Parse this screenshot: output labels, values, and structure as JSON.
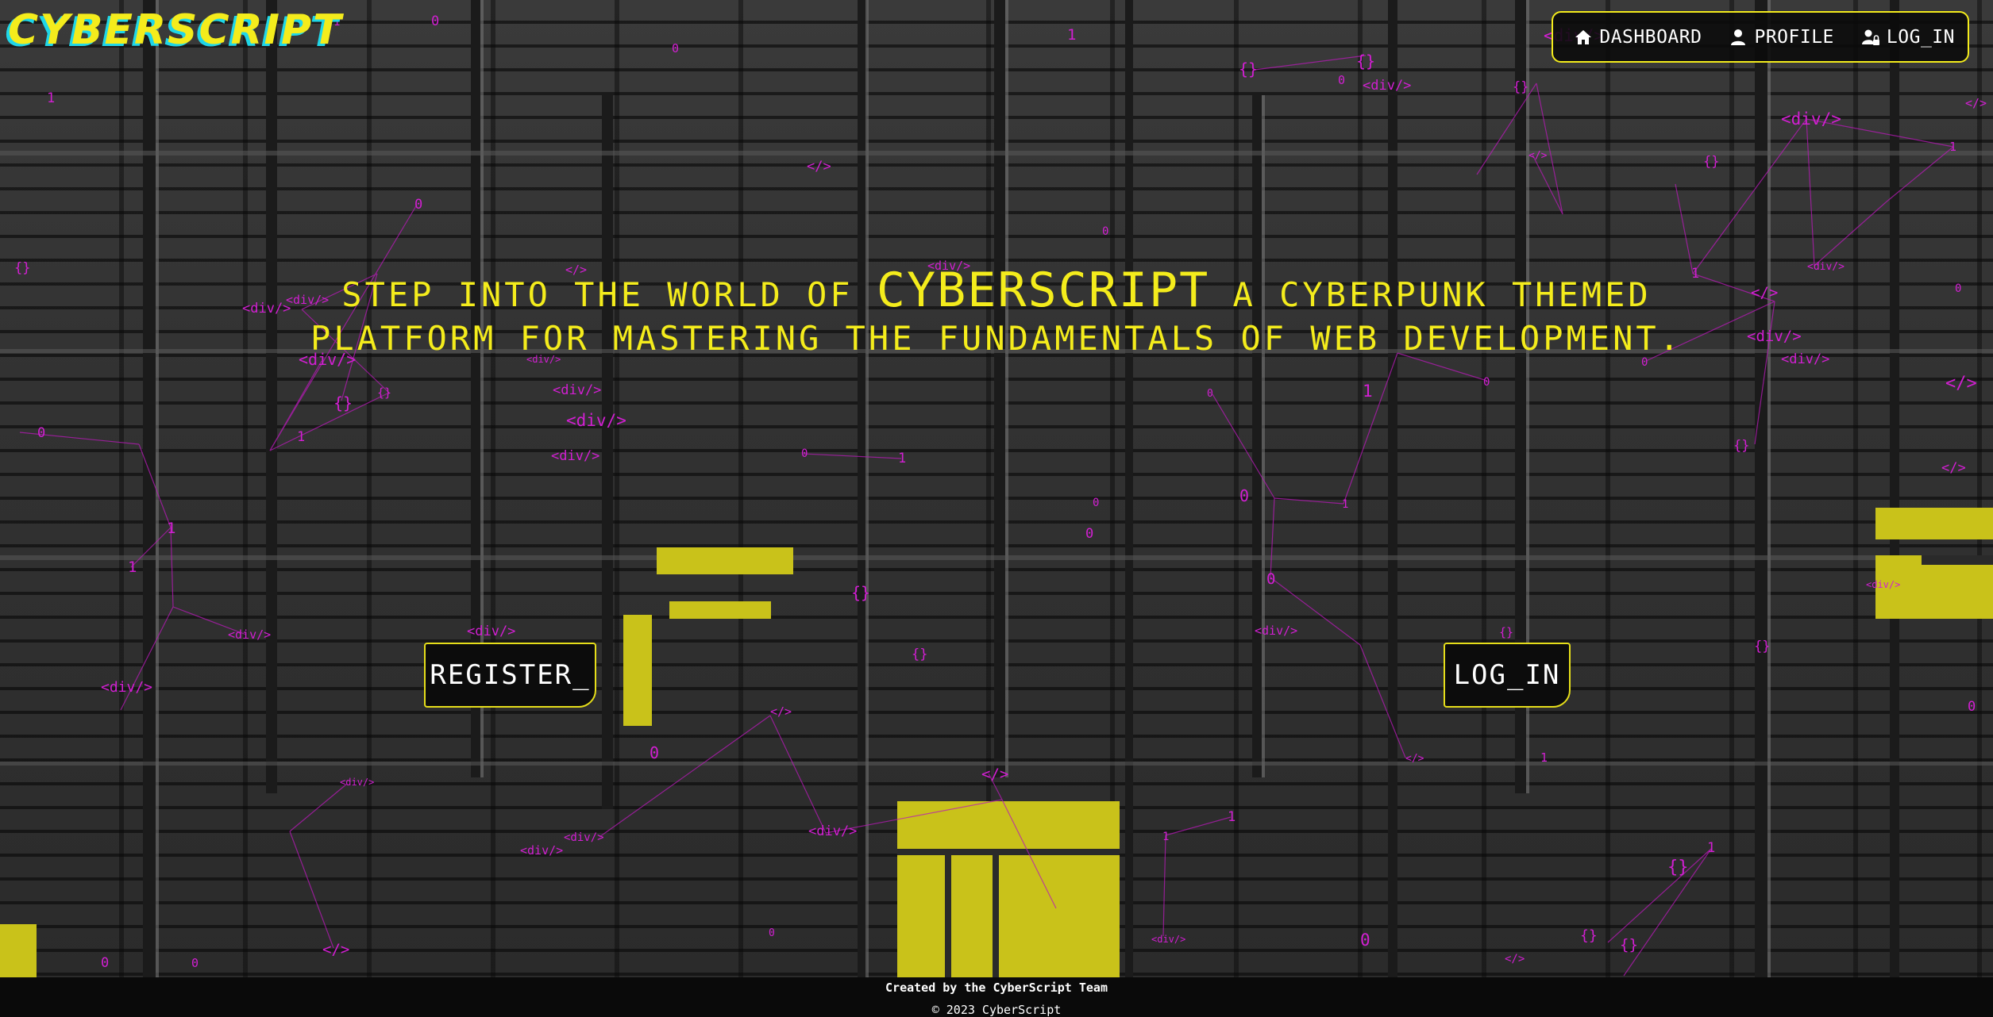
{
  "brand": {
    "logo_text": "CYBERSCRIPT",
    "primary_color": "#f4ec1c",
    "shadow_color": "#1fd6e8",
    "accent_color": "#d21fd2"
  },
  "nav": {
    "items": [
      {
        "label": "DASHBOARD",
        "icon": "home-icon"
      },
      {
        "label": "PROFILE",
        "icon": "user-icon"
      },
      {
        "label": "LOG_IN",
        "icon": "user-lock-icon"
      }
    ]
  },
  "hero": {
    "line1_before": "STEP INTO THE WORLD OF",
    "brand_word": "CYBERSCRIPT",
    "line1_after": "A CYBERPUNK THEMED",
    "line2": "PLATFORM FOR MASTERING THE FUNDAMENTALS OF WEB DEVELOPMENT."
  },
  "actions": {
    "register_label": "REGISTER_",
    "login_label": "LOG_IN"
  },
  "footer": {
    "credit": "Created by the CyberScript Team",
    "copyright": "© 2023 CyberScript"
  },
  "background_tokens": [
    "<div/>",
    "</>",
    "{}",
    "0",
    "1"
  ]
}
